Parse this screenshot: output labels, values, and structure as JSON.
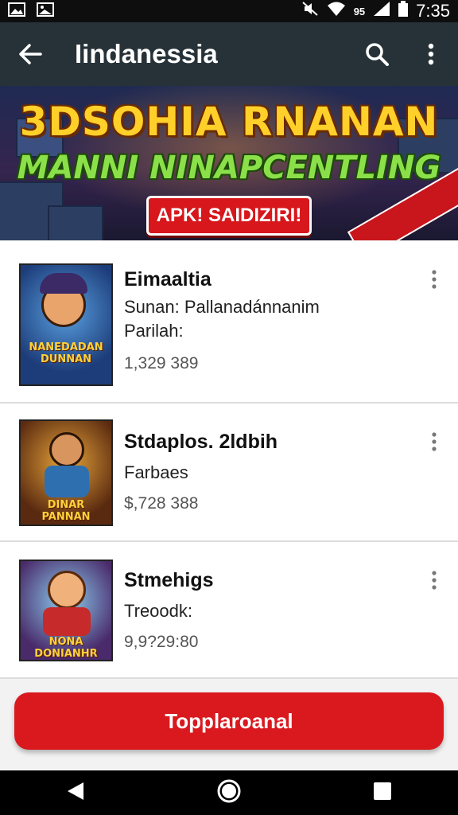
{
  "status_bar": {
    "time": "7:35",
    "network": "95",
    "icons": [
      "image-icon",
      "gallery-icon",
      "mute-icon",
      "wifi-icon",
      "signal-icon",
      "battery-icon"
    ]
  },
  "app_bar": {
    "title": "Iindanessia",
    "icons": [
      "back-arrow-icon",
      "search-icon",
      "more-vert-icon"
    ],
    "background": "#263238"
  },
  "banner": {
    "headline": "3DSOHIA RNANAN",
    "subline": "MANNI NINAPCENTLING",
    "badge": "APK! SAIDIZIRI!"
  },
  "apps": [
    {
      "name": "Eimaaltia",
      "description": "Sunan: Pallanadánnanim Parilah:",
      "count": "1,329 389",
      "art_text": "NANEDADAN DUNNAN"
    },
    {
      "name": "Stdaplos. 2ldbih",
      "description": "Farbaes",
      "count": "$,728 388",
      "art_text": "DINAR PANNAN"
    },
    {
      "name": "Stmehigs",
      "description": "Treoodk:",
      "count": "9,9?29:80",
      "art_text": "NONA DONIANHR"
    }
  ],
  "cta": {
    "label": "Topplaroanal",
    "color": "#d9191e"
  },
  "nav_bar": {
    "icons": [
      "back-triangle-icon",
      "home-circle-icon",
      "recents-square-icon"
    ]
  }
}
